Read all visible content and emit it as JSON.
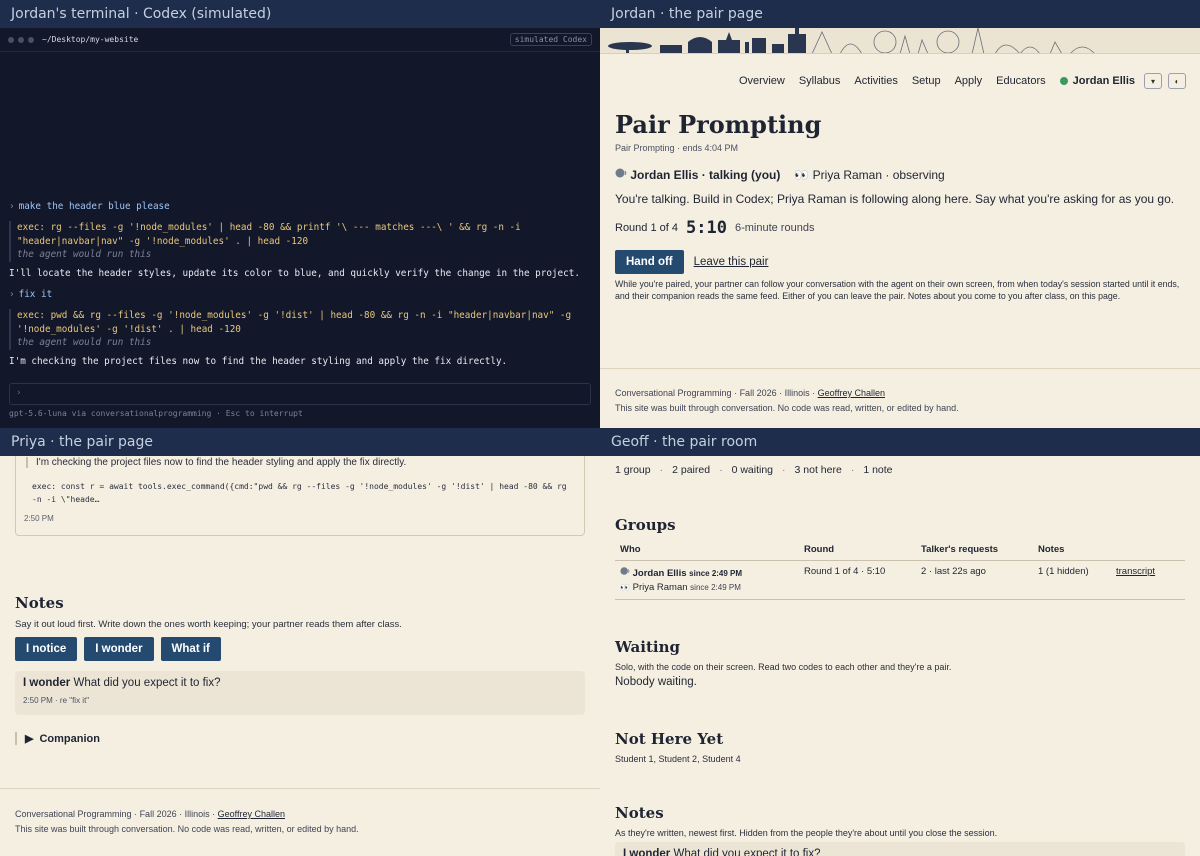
{
  "q1": {
    "header": "Jordan's terminal · Codex (simulated)",
    "path": "~/Desktop/my-website",
    "badge": "simulated Codex",
    "prompt1": "make the header blue please",
    "exec1_line1": "exec: rg --files -g '!node_modules' | head -80 && printf '\\ --- matches ---\\ ' && rg -n -i",
    "exec1_line2": "\"header|navbar|nav\" -g '!node_modules' . | head -120",
    "exec_note": "the agent would run this",
    "agent1": "I'll locate the header styles, update its color to blue, and quickly verify the change in the project.",
    "prompt2": "fix it",
    "exec2_line1": "exec: pwd && rg --files -g '!node_modules' -g '!dist' | head -80 && rg -n -i \"header|navbar|nav\" -g",
    "exec2_line2": "'!node_modules' -g '!dist' . | head -120",
    "agent2": "I'm checking the project files now to find the header styling and apply the fix directly.",
    "input_prompt": "›",
    "status": "gpt-5.6-luna via conversationalprogramming  ·  Esc to interrupt"
  },
  "q2": {
    "header": "Jordan · the pair page",
    "nav": [
      "Overview",
      "Syllabus",
      "Activities",
      "Setup",
      "Apply",
      "Educators"
    ],
    "user": "Jordan Ellis",
    "dropdown_icon": "▾",
    "theme_icon": "◐",
    "title": "Pair Prompting",
    "subtitle": "Pair Prompting · ends 4:04 PM",
    "talker": "Jordan Ellis · talking (you)",
    "observer": "Priya Raman · observing",
    "talk_line": "You're talking. Build in Codex; Priya Raman is following along here. Say what you're asking for as you go.",
    "round": "Round 1 of 4",
    "timer": "5:10",
    "round_len": "6-minute rounds",
    "handoff": "Hand off",
    "leave": "Leave this pair",
    "explain": "While you're paired, your partner can follow your conversation with the agent on their own screen, from when today's session started until it ends, and their companion reads the same feed. Either of you can leave the pair. Notes about you come to you after class, on this page.",
    "footer_course": "Conversational Programming",
    "footer_term": "Fall 2026",
    "footer_school": "Illinois",
    "footer_author": "Geoffrey Challen",
    "footer_note": "This site was built through conversation. No code was read, written, or edited by hand."
  },
  "q3": {
    "header": "Priya · the pair page",
    "quote": "I'm checking the project files now to find the header styling and apply the fix directly.",
    "code_line1": "exec: const r = await tools.exec_command({cmd:\"pwd && rg --files -g '!node_modules' -g '!dist' | head -80 && rg",
    "code_line2": "-n -i \\\"heade…",
    "time": "2:50 PM",
    "notes_title": "Notes",
    "notes_hint": "Say it out loud first. Write down the ones worth keeping; your partner reads them after class.",
    "btn_notice": "I notice",
    "btn_wonder": "I wonder",
    "btn_whatif": "What if",
    "note_kind": "I wonder",
    "note_text": "What did you expect it to fix?",
    "note_meta": "2:50 PM · re \"fix it\"",
    "companion": "Companion",
    "footer_course": "Conversational Programming",
    "footer_term": "Fall 2026",
    "footer_school": "Illinois",
    "footer_author": "Geoffrey Challen",
    "footer_note": "This site was built through conversation. No code was read, written, or edited by hand."
  },
  "q4": {
    "header": "Geoff · the pair room",
    "stats": [
      "1 group",
      "2 paired",
      "0 waiting",
      "3 not here",
      "1 note"
    ],
    "groups_title": "Groups",
    "cols": [
      "Who",
      "Round",
      "Talker's requests",
      "Notes"
    ],
    "row_talker": "Jordan Ellis",
    "row_talker_since": "since 2:49 PM",
    "row_observer": "Priya Raman",
    "row_observer_since": "since 2:49 PM",
    "row_round": "Round 1 of 4 · 5:10",
    "row_requests": "2 · last 22s ago",
    "row_notes": "1 (1 hidden)",
    "row_link": "transcript",
    "waiting_title": "Waiting",
    "waiting_hint": "Solo, with the code on their screen. Read two codes to each other and they're a pair.",
    "waiting_empty": "Nobody waiting.",
    "nothere_title": "Not Here Yet",
    "nothere_list": "Student 1, Student 2, Student 4",
    "notes_title": "Notes",
    "notes_hint": "As they're written, newest first. Hidden from the people they're about until you close the session.",
    "note_kind": "I wonder",
    "note_text": "What did you expect it to fix?"
  }
}
